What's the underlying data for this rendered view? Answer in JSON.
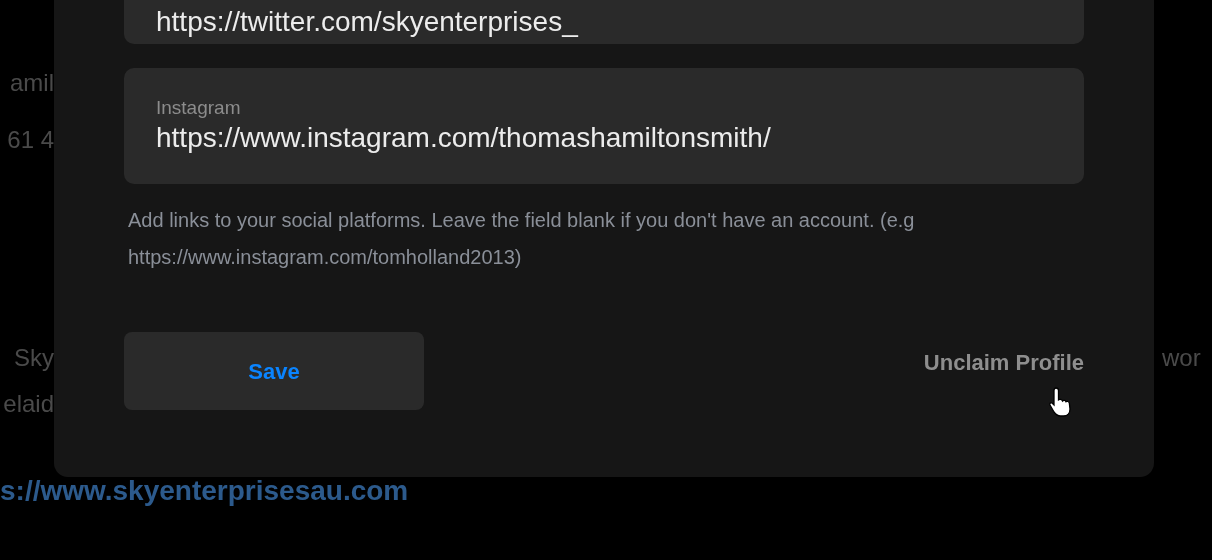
{
  "background_page": {
    "left_fragments": [
      "amil",
      "61 4",
      "Sky",
      "elaid"
    ],
    "right_fragments": [
      "wor"
    ],
    "website_link": "s://www.skyenterprisesau.com"
  },
  "dialog": {
    "fields": [
      {
        "value": "https://twitter.com/skyenterprises_"
      },
      {
        "label": "Instagram",
        "value": "https://www.instagram.com/thomashamiltonsmith/"
      }
    ],
    "help_text": "Add links to your social platforms. Leave the field blank if you don't have an account. (e.g https://www.instagram.com/tomholland2013)",
    "save_button": "Save",
    "unclaim_link": "Unclaim Profile"
  }
}
